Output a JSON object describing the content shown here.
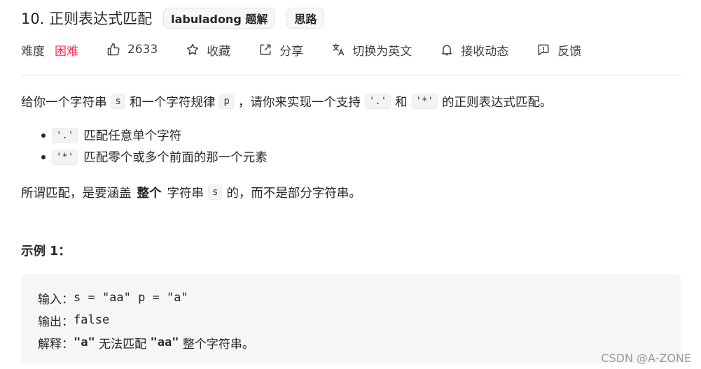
{
  "problem": {
    "title": "10. 正则表达式匹配",
    "tags": [
      "labuladong 题解",
      "思路"
    ]
  },
  "meta": {
    "difficulty_label": "难度",
    "difficulty_value": "困难",
    "likes": "2633",
    "favorite": "收藏",
    "share": "分享",
    "translate": "切换为英文",
    "notify": "接收动态",
    "feedback": "反馈",
    "colors": {
      "difficulty": "#ff2d55"
    }
  },
  "description": {
    "p1_a": "给你一个字符串",
    "p1_s": "s",
    "p1_b": "和一个字符规律",
    "p1_p": "p",
    "p1_c": "，请你来实现一个支持",
    "p1_dot": "'.'",
    "p1_d": "和",
    "p1_star": "'*'",
    "p1_e": "的正则表达式匹配。",
    "rules": [
      {
        "code": "'.'",
        "text": "匹配任意单个字符"
      },
      {
        "code": "'*'",
        "text": "匹配零个或多个前面的那一个元素"
      }
    ],
    "p2_a": "所谓匹配，是要涵盖",
    "p2_strong": "整个",
    "p2_b": "字符串",
    "p2_s": "s",
    "p2_c": "的，而不是部分字符串。"
  },
  "example": {
    "title": "示例 1：",
    "input_label": "输入：",
    "input_value": "s = \"aa\" p = \"a\"",
    "output_label": "输出：",
    "output_value": "false",
    "explain_label": "解释：",
    "explain_a": "\"a\"",
    "explain_b": " 无法匹配 ",
    "explain_c": "\"aa\"",
    "explain_d": " 整个字符串。"
  },
  "watermark": "CSDN @A-ZONE"
}
